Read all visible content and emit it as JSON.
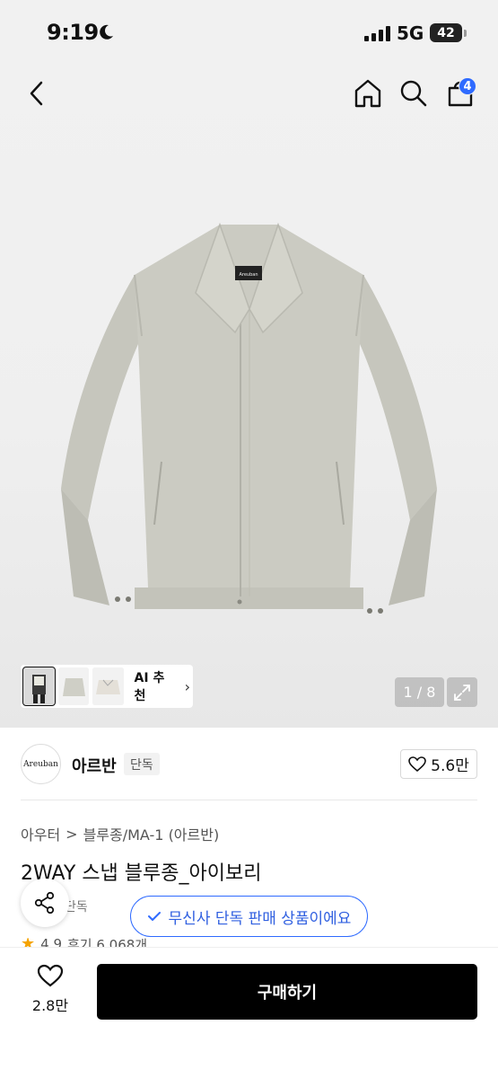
{
  "status_bar": {
    "time": "9:19",
    "network": "5G",
    "battery": "42"
  },
  "header": {
    "cart_count": "4",
    "icons": [
      "back-icon",
      "home-icon",
      "search-icon",
      "cart-icon"
    ]
  },
  "gallery": {
    "ai_label": "AI 추천",
    "page_indicator": "1 / 8",
    "garment_label": "Areuban"
  },
  "brand": {
    "logo_text": "Areuban",
    "name": "아르반",
    "tag": "단독",
    "likes": "5.6만"
  },
  "breadcrumb": {
    "category": "아우터",
    "separator": ">",
    "subcategory": "블루종/MA-1 (아르반)"
  },
  "product": {
    "title": "2WAY 스냅 블루종_아이보리",
    "behind_tag": "단독",
    "exclusive_notice": "무신사 단독 판매 상품이에요",
    "rating": "4.9",
    "reviews": "후기 6,068개"
  },
  "bottom_bar": {
    "wish_count": "2.8만",
    "buy_label": "구매하기"
  },
  "colors": {
    "accent": "#2f6bff",
    "garment": "#c9c9c0",
    "primary_button": "#000000"
  }
}
